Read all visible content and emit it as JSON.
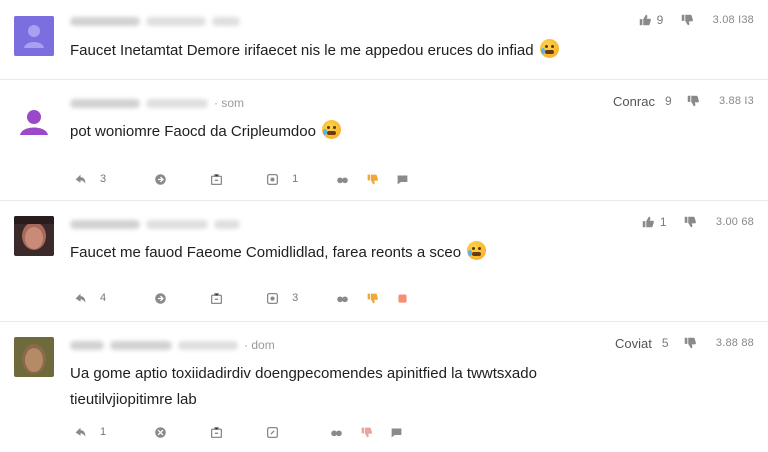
{
  "comments": [
    {
      "body": "Faucet Inetamtat  Demore irifaecet nis le me appedou eruces do infiad",
      "meta_suffix": "",
      "label": "",
      "likes": "9",
      "timestamp": "3.08 I38",
      "actions": null
    },
    {
      "body": "pot woniomre Faocd da Cripleumdoo",
      "meta_suffix": "som",
      "label": "Conrac",
      "likes": "9",
      "timestamp": "3.88 I3",
      "actions": {
        "reply": "3",
        "share": "",
        "save": "",
        "quote": "1"
      }
    },
    {
      "body": "Faucet me fauod  Faeome Comidlidlad, farea reonts a sceo",
      "meta_suffix": "",
      "label": "",
      "likes": "1",
      "timestamp": "3.00 68",
      "actions": {
        "reply": "4",
        "share": "",
        "save": "",
        "quote": "3"
      }
    },
    {
      "body_lines": [
        "Ua gome aptio toxiidadirdiv doengpecomendes apinitfied la twwtsxado",
        "tieutilvjiopitimre lab"
      ],
      "meta_suffix": "dom",
      "label": "Coviat",
      "likes": "5",
      "timestamp": "3.88 88",
      "actions": {
        "reply": "1",
        "share": "",
        "save": "",
        "quote": ""
      }
    }
  ],
  "colors": {
    "avatar1": "#7b6fe0",
    "avatar2": "#9b49c9",
    "dislike_accent": "#f2a73b",
    "dislike_alt": "#e9a1a1",
    "flag_accent": "#f37a5c"
  }
}
